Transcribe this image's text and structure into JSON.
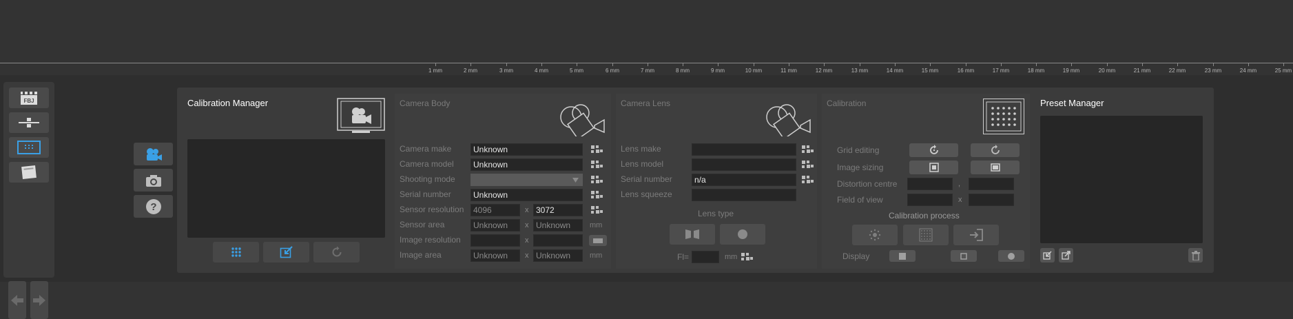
{
  "ruler": {
    "labels": [
      "1 mm",
      "2 mm",
      "3 mm",
      "4 mm",
      "5 mm",
      "6 mm",
      "7 mm",
      "8 mm",
      "9 mm",
      "10 mm",
      "11 mm",
      "12 mm",
      "13 mm",
      "14 mm",
      "15 mm",
      "16 mm",
      "17 mm",
      "18 mm",
      "19 mm",
      "20 mm",
      "21 mm",
      "22 mm",
      "23 mm",
      "24 mm",
      "25 mm"
    ]
  },
  "left_toolbar": {
    "buttons": [
      {
        "icon": "clapperboard-icon",
        "label": "FBJ"
      },
      {
        "icon": "horizon-slider-icon"
      },
      {
        "icon": "grid-frame-icon",
        "active": true
      },
      {
        "icon": "note-icon"
      }
    ]
  },
  "nav": {
    "buttons": [
      "camera-icon",
      "photo-camera-icon",
      "help-icon"
    ],
    "help_glyph": "?"
  },
  "calibration_manager": {
    "title": "Calibration Manager"
  },
  "camera_body": {
    "title": "Camera Body",
    "labels": {
      "make": "Camera make",
      "model": "Camera model",
      "shooting_mode": "Shooting mode",
      "serial": "Serial number",
      "sensor_res": "Sensor resolution",
      "sensor_area": "Sensor area",
      "image_res": "Image resolution",
      "image_area": "Image area"
    },
    "values": {
      "make": "Unknown",
      "model": "Unknown",
      "shooting_mode": "",
      "serial": "Unknown",
      "sensor_res_w": "4096",
      "sensor_res_h": "3072",
      "sensor_area_w": "Unknown",
      "sensor_area_h": "Unknown",
      "image_res_w": "",
      "image_res_h": "",
      "image_area_w": "Unknown",
      "image_area_h": "Unknown"
    },
    "x": "x",
    "unit_mm": "mm"
  },
  "camera_lens": {
    "title": "Camera Lens",
    "labels": {
      "make": "Lens make",
      "model": "Lens model",
      "serial": "Serial number",
      "squeeze": "Lens squeeze"
    },
    "values": {
      "make": "",
      "model": "",
      "serial": "n/a",
      "squeeze": ""
    },
    "lens_type_label": "Lens type",
    "fl_label": "Fl=",
    "fl_value": "",
    "fl_unit": "mm"
  },
  "calibration": {
    "title": "Calibration",
    "labels": {
      "grid_editing": "Grid editing",
      "image_sizing": "Image sizing",
      "distortion_centre": "Distortion centre",
      "field_of_view": "Field of view"
    },
    "sep_comma": ",",
    "sep_x": "x",
    "process_label": "Calibration process",
    "display_label": "Display"
  },
  "preset_manager": {
    "title": "Preset Manager"
  },
  "colors": {
    "accent": "#3aa0e6",
    "panel": "#3e3e3e",
    "field": "#262626"
  }
}
